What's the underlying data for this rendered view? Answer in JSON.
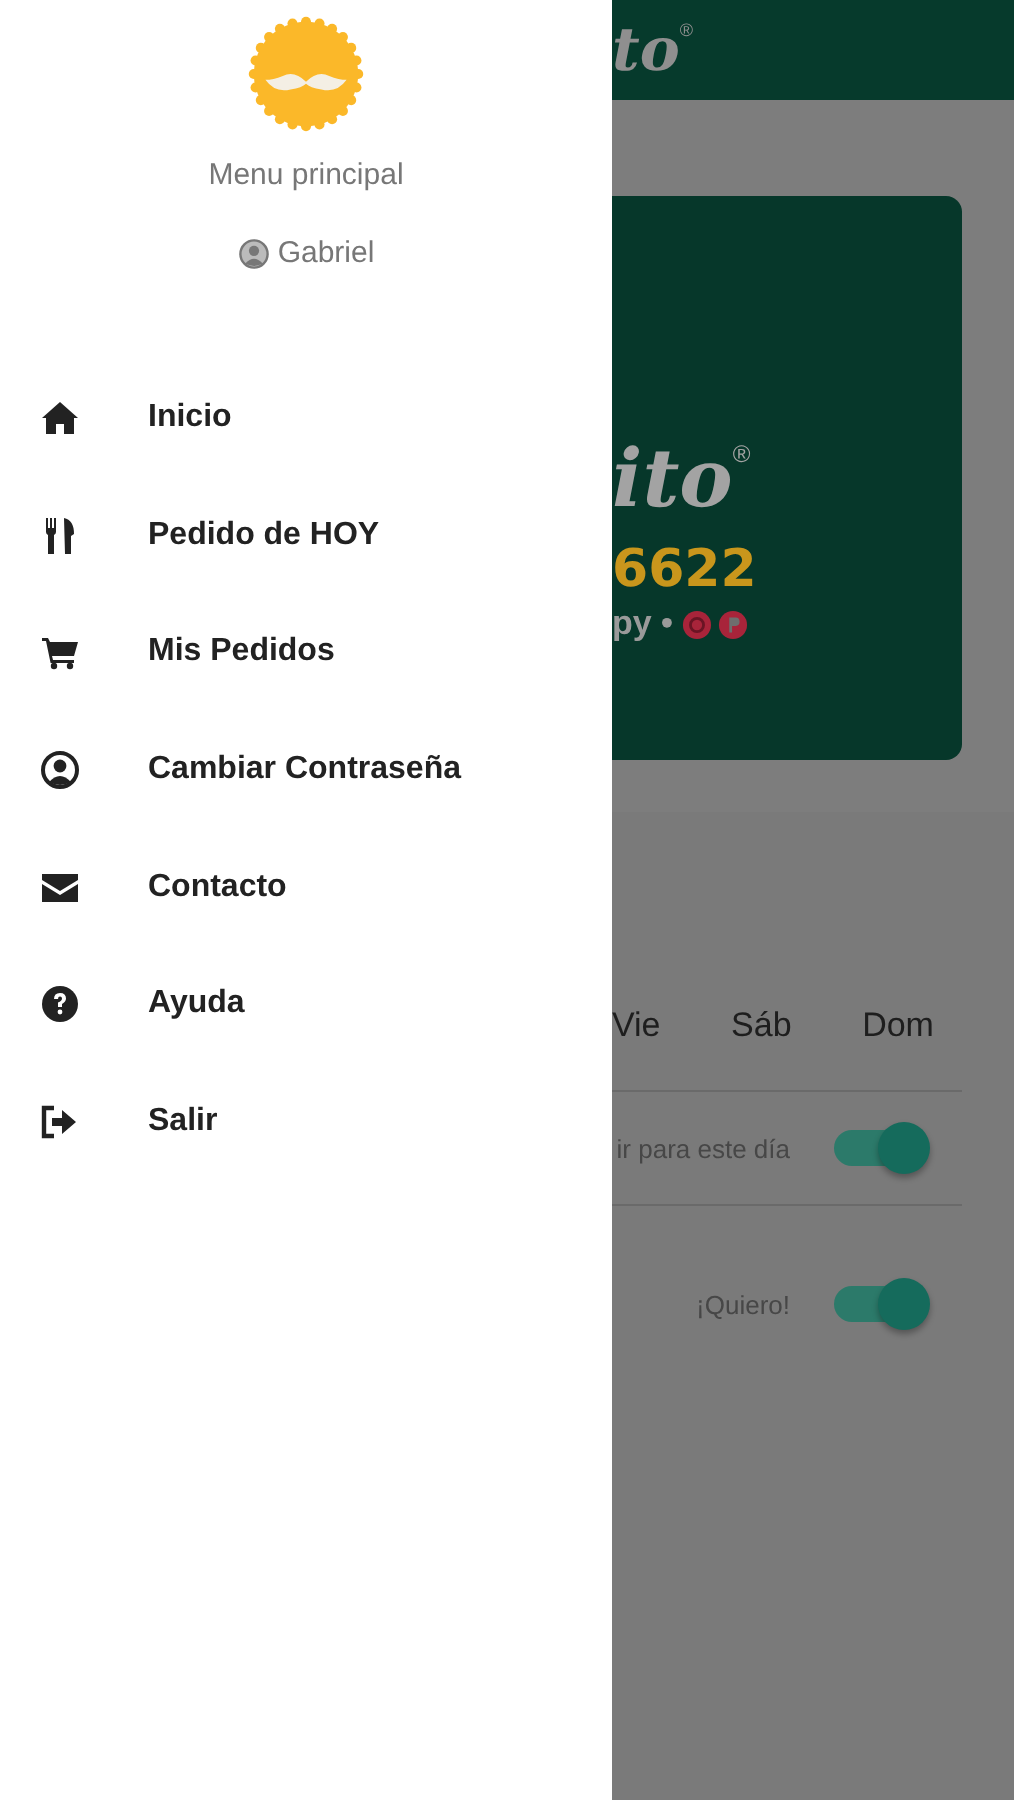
{
  "drawer": {
    "title": "Menu principal",
    "user": "Gabriel",
    "items": [
      {
        "label": "Inicio"
      },
      {
        "label": "Pedido de HOY"
      },
      {
        "label": "Mis Pedidos"
      },
      {
        "label": "Cambiar Contraseña"
      },
      {
        "label": "Contacto"
      },
      {
        "label": "Ayuda"
      },
      {
        "label": "Salir"
      }
    ]
  },
  "background": {
    "header": {
      "logo": "to",
      "mark": "®"
    },
    "card": {
      "logo": "ito",
      "mark": "®",
      "phone": "6622",
      "payments": "py •"
    },
    "days": [
      "Vie",
      "Sáb",
      "Dom"
    ],
    "rows": [
      {
        "label": "ir para este día",
        "on": true
      },
      {
        "label": "¡Quiero!",
        "on": true
      }
    ]
  }
}
